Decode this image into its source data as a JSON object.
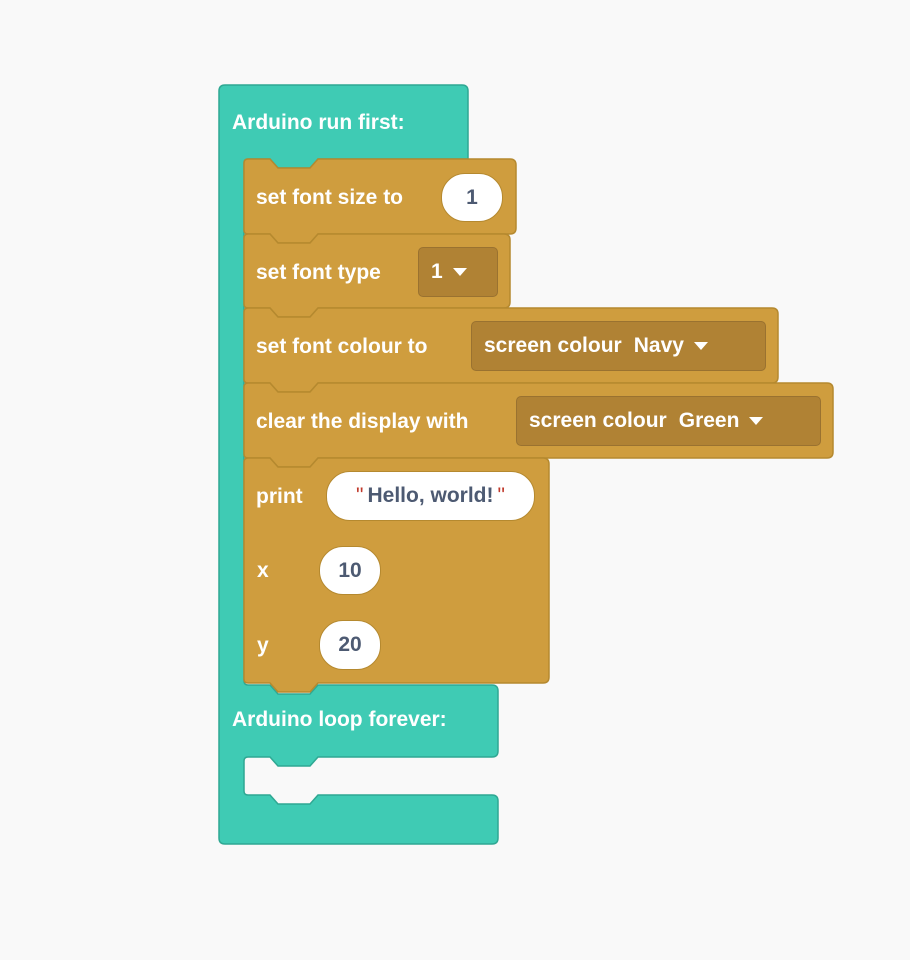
{
  "colors": {
    "background": "#f9f9f9",
    "hat_block": "#3fcbb4",
    "hat_block_border": "#2fa893",
    "display_block": "#cf9d3e",
    "display_block_border": "#b5892f",
    "dropdown_field": "#b08234",
    "input_text": "#4d5a72",
    "quote_mark": "#c0392b"
  },
  "setup_block": {
    "label": "Arduino run first:",
    "statements": [
      {
        "label": "set font size to",
        "value": "1"
      },
      {
        "label": "set font type",
        "value": "1",
        "dropdown_icon": "dropdown-arrow-icon"
      },
      {
        "label": "set font colour to",
        "dropdown_prefix": "screen colour",
        "dropdown_value": "Navy",
        "dropdown_icon": "dropdown-arrow-icon"
      },
      {
        "label": "clear the display with",
        "dropdown_prefix": "screen colour",
        "dropdown_value": "Green",
        "dropdown_icon": "dropdown-arrow-icon"
      },
      {
        "label": "print",
        "text_value": "Hello, world!",
        "quote_open": "\"",
        "quote_close": "\"",
        "x_label": "x",
        "x_value": "10",
        "y_label": "y",
        "y_value": "20"
      }
    ]
  },
  "loop_block": {
    "label": "Arduino loop forever:"
  }
}
